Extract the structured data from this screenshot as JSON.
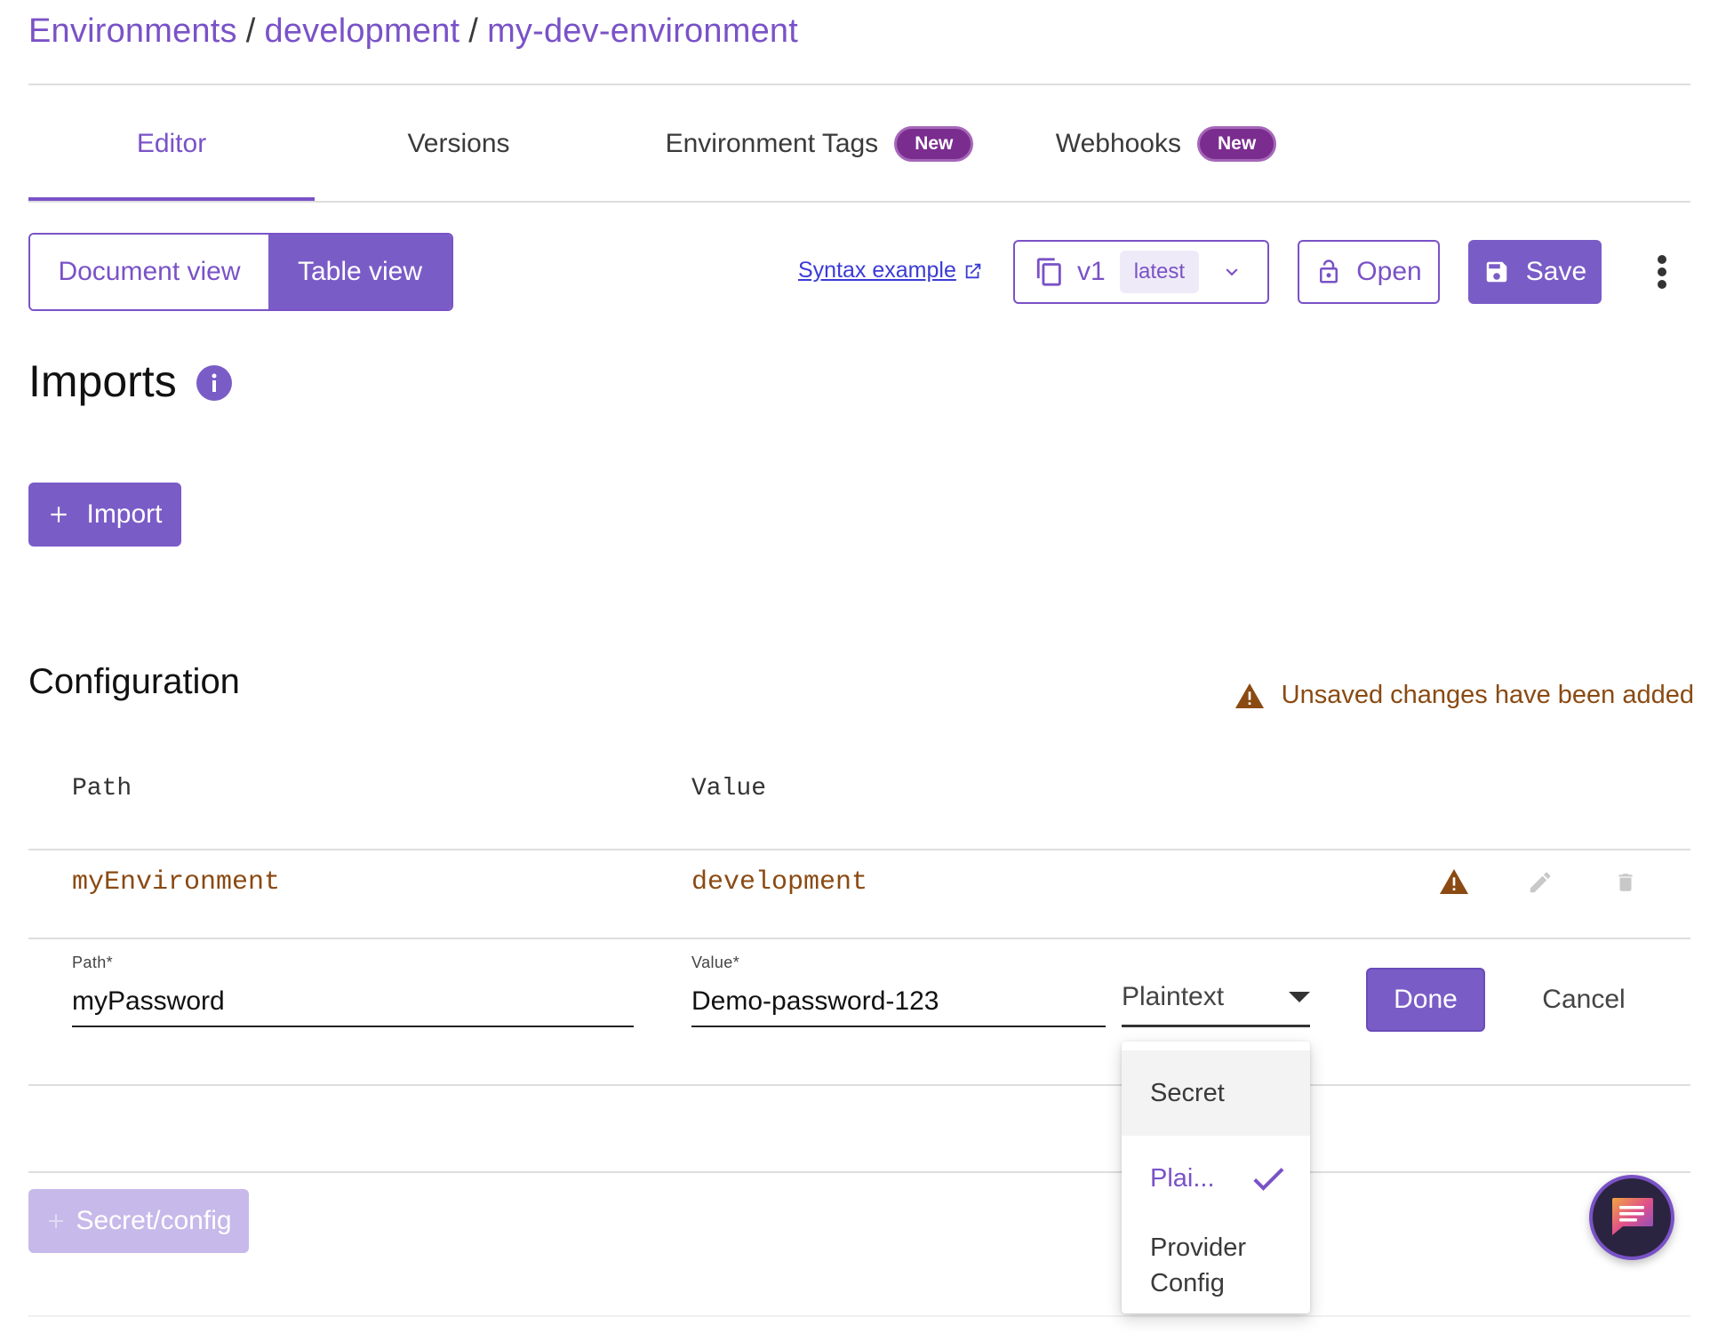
{
  "breadcrumb": {
    "items": [
      "Environments",
      "development",
      "my-dev-environment"
    ],
    "separator": "/"
  },
  "tabs": [
    {
      "label": "Editor",
      "active": true
    },
    {
      "label": "Versions"
    },
    {
      "label": "Environment Tags",
      "badge": "New"
    },
    {
      "label": "Webhooks",
      "badge": "New"
    }
  ],
  "toolbar": {
    "document_view": "Document view",
    "table_view": "Table view",
    "syntax_link": "Syntax example",
    "version": "v1",
    "version_tag": "latest",
    "open_label": "Open",
    "save_label": "Save"
  },
  "imports": {
    "title": "Imports",
    "import_button": "Import"
  },
  "configuration": {
    "title": "Configuration",
    "unsaved_notice": "Unsaved changes have been added",
    "columns": {
      "path": "Path",
      "value": "Value"
    },
    "rows": [
      {
        "path": "myEnvironment",
        "value": "development"
      }
    ],
    "edit_row": {
      "path_label": "Path*",
      "path_value": "myPassword",
      "value_label": "Value*",
      "value_value": "Demo-password-123",
      "type_selected": "Plaintext",
      "done_label": "Done",
      "cancel_label": "Cancel"
    },
    "add_button": "Secret/config"
  },
  "type_dropdown": {
    "options": [
      "Secret",
      "Plai...",
      "Provider Config"
    ],
    "selected_index": 1
  },
  "colors": {
    "accent": "#7a52c7",
    "badge": "#7b2d8f",
    "warning": "#8a4a12"
  }
}
